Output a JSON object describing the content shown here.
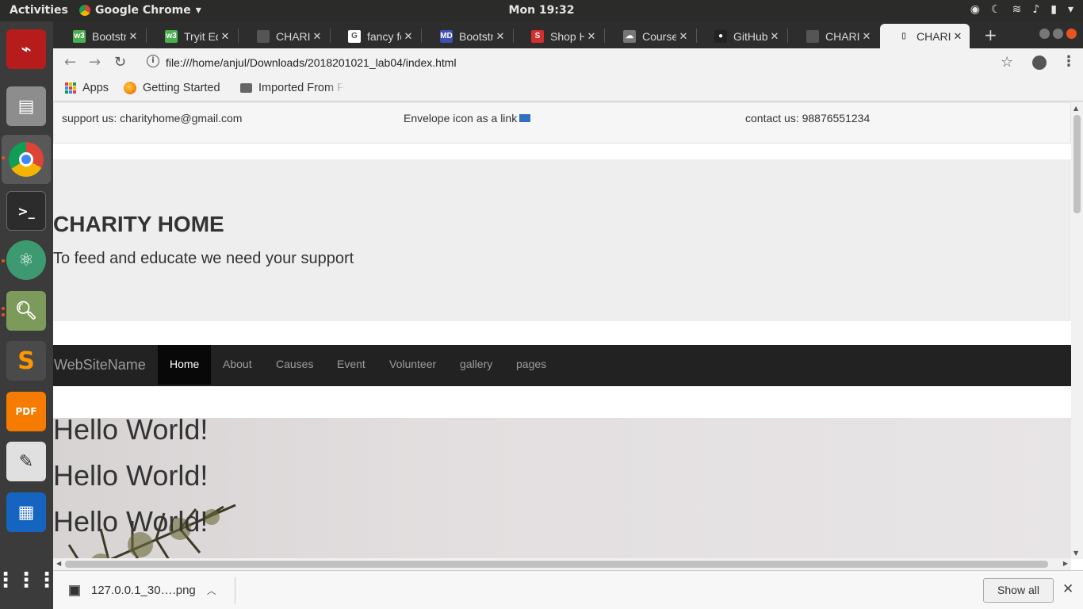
{
  "topbar": {
    "activities": "Activities",
    "app_name": "Google Chrome",
    "app_menu_arrow": "▾",
    "clock": "Mon 19:32"
  },
  "dock": {
    "items": [
      "acrobat-icon",
      "files-icon",
      "chrome-icon",
      "terminal-icon",
      "atom-icon",
      "image-viewer-icon",
      "sublime-icon",
      "pdf-editor-icon",
      "text-editor-icon",
      "writer-icon",
      "app-grid-icon"
    ]
  },
  "tabs": [
    {
      "title": "Bootstr",
      "fav_color": "#4caf50",
      "fav_text": "w3"
    },
    {
      "title": "Tryit Ed",
      "fav_color": "#4caf50",
      "fav_text": "w3"
    },
    {
      "title": "CHARIT",
      "fav_color": "#555555",
      "fav_text": ""
    },
    {
      "title": "fancy fo",
      "fav_color": "#ffffff",
      "fav_text": "G"
    },
    {
      "title": "Bootstr",
      "fav_color": "#3f51b5",
      "fav_text": "MD"
    },
    {
      "title": "Shop H",
      "fav_color": "#d32f2f",
      "fav_text": "S"
    },
    {
      "title": "Course",
      "fav_color": "#777777",
      "fav_text": "☁"
    },
    {
      "title": "GitHub",
      "fav_color": "#222222",
      "fav_text": "●"
    },
    {
      "title": "CHARIT",
      "fav_color": "#555555",
      "fav_text": ""
    },
    {
      "title": "CHARIT",
      "fav_color": "#f2f2f2",
      "fav_text": "▯"
    }
  ],
  "toolbar": {
    "url": "file:///home/anjul/Downloads/2018201021_lab04/index.html",
    "info_label": "i"
  },
  "bookmarks": {
    "apps": "Apps",
    "getting_started": "Getting Started",
    "imported": "Imported From F"
  },
  "page": {
    "support": "support us: charityhome@gmail.com",
    "envelope_text": "Envelope icon as a link",
    "contact": "contact us: 98876551234",
    "title": "CHARITY HOME",
    "subtitle": "To feed and educate we need your support",
    "brand": "WebSiteName",
    "nav": [
      "Home",
      "About",
      "Causes",
      "Event",
      "Volunteer",
      "gallery",
      "pages"
    ],
    "hello": [
      "Hello World!",
      "Hello World!",
      "Hello World!"
    ]
  },
  "downloads": {
    "file": "127.0.0.1_30….png",
    "show_all": "Show all"
  },
  "colors": {
    "navbar_bg": "#222222",
    "jumbotron_bg": "#eeeeee",
    "accent": "#e95420"
  }
}
